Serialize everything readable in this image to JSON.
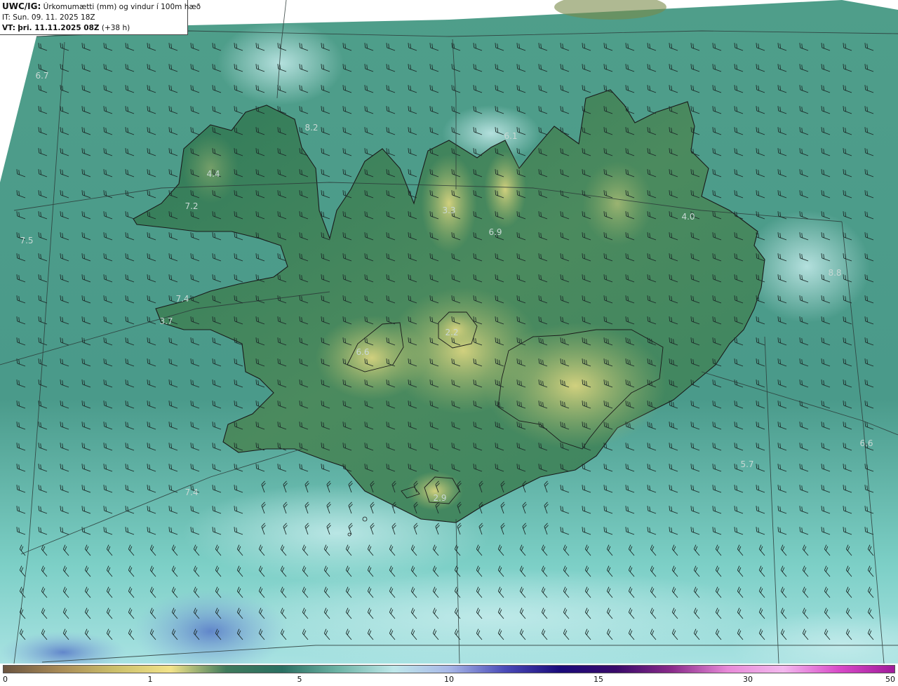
{
  "header": {
    "product": "UWC/IG:",
    "title": "Úrkomumætti (mm) og vindur í 100m hæð",
    "it_label": "IT:",
    "it_value": "Sun. 09. 11. 2025 18Z",
    "vt_label": "VT:",
    "vt_value": "þri. 11.11.2025 08Z",
    "lead": "(+38 h)"
  },
  "map_values": [
    "6.7",
    "8.2",
    "6.1",
    "4.4",
    "7.2",
    "3.3",
    "6.9",
    "4.0",
    "7.5",
    "8.8",
    "7.4",
    "3.7",
    "2.2",
    "6.6",
    "6.6",
    "5.7",
    "7.4",
    "2.9"
  ],
  "legend": {
    "ticks": [
      "0",
      "1",
      "5",
      "10",
      "15",
      "30",
      "50"
    ],
    "colors": [
      "#6b5440",
      "#a88a56",
      "#cbbf6a",
      "#f2e38a",
      "#3f7a5c",
      "#2a6f62",
      "#6db3a5",
      "#bfe8ea",
      "#a8b8e8",
      "#4a4ab8",
      "#1a0a7a",
      "#3a0a6a",
      "#8a2a8a",
      "#e88ad8",
      "#f3b8ee",
      "#d84ac8",
      "#a01a9a"
    ]
  },
  "colors": {
    "sea_base": "#4a9a8a",
    "land_low": "#2f7a5a",
    "land_high": "#c9c47a",
    "coast": "#1a1a1a",
    "grid": "#2c3a38"
  },
  "icons": [
    "wind-barb-icon"
  ]
}
